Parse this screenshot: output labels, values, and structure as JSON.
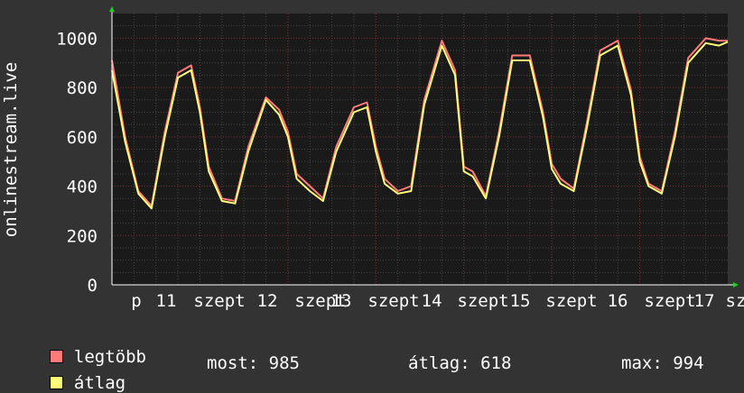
{
  "chart_data": {
    "type": "line",
    "ylabel": "onlinestream.live",
    "ylim": [
      0,
      1100
    ],
    "y_ticks": [
      "0",
      "200",
      "400",
      "600",
      "800",
      "1000"
    ],
    "x_tick_labels": [
      "p",
      "11",
      "szept",
      "12",
      "szept",
      "13",
      "szept",
      "14",
      "szept",
      "15",
      "szept",
      "16",
      "szept",
      "17",
      "sz"
    ],
    "grid": true,
    "x": [
      0,
      0.15,
      0.3,
      0.45,
      0.6,
      0.75,
      0.9,
      1.0,
      1.1,
      1.25,
      1.4,
      1.55,
      1.75,
      1.9,
      2.0,
      2.1,
      2.25,
      2.4,
      2.55,
      2.75,
      2.9,
      3.0,
      3.1,
      3.25,
      3.4,
      3.55,
      3.75,
      3.9,
      4.0,
      4.1,
      4.25,
      4.4,
      4.55,
      4.75,
      4.9,
      5.0,
      5.1,
      5.25,
      5.4,
      5.55,
      5.75,
      5.9,
      6.0,
      6.1,
      6.25,
      6.4,
      6.55,
      6.75,
      6.9,
      7.0
    ],
    "series": [
      {
        "name": "legtöbb",
        "color": "#ff7a7a",
        "values": [
          910,
          600,
          380,
          320,
          620,
          860,
          890,
          720,
          480,
          350,
          340,
          560,
          760,
          710,
          620,
          450,
          400,
          350,
          560,
          720,
          740,
          560,
          430,
          380,
          400,
          750,
          990,
          870,
          480,
          460,
          360,
          620,
          930,
          930,
          700,
          490,
          430,
          390,
          660,
          950,
          990,
          790,
          520,
          410,
          380,
          620,
          920,
          1000,
          990,
          990
        ]
      },
      {
        "name": "átlag",
        "color": "#ffff7a",
        "values": [
          870,
          580,
          370,
          310,
          600,
          840,
          870,
          700,
          460,
          340,
          330,
          540,
          750,
          690,
          600,
          430,
          380,
          340,
          540,
          700,
          720,
          540,
          410,
          370,
          380,
          730,
          970,
          850,
          460,
          440,
          350,
          600,
          910,
          910,
          680,
          470,
          410,
          380,
          640,
          930,
          970,
          770,
          500,
          400,
          370,
          600,
          900,
          980,
          970,
          985
        ]
      }
    ]
  },
  "legend": {
    "items": [
      {
        "label": "legtöbb",
        "color": "#ff7a7a"
      },
      {
        "label": "átlag",
        "color": "#ffff7a"
      }
    ],
    "stats": {
      "now": "most: 985",
      "avg": "átlag: 618",
      "max": "max: 994"
    }
  }
}
